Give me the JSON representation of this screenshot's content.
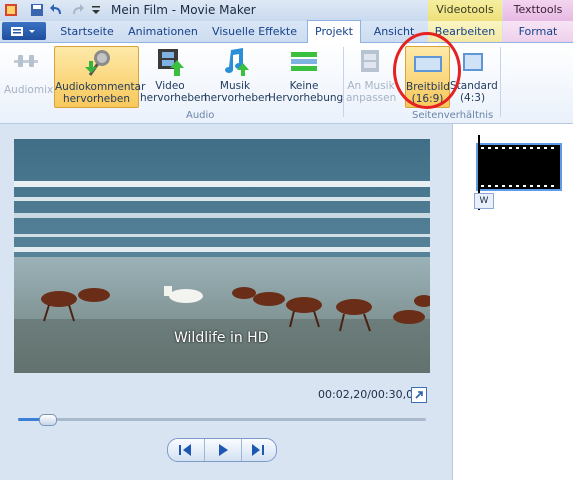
{
  "window": {
    "title": "Mein Film - Movie Maker"
  },
  "context_tabs": {
    "video": "Videotools",
    "text": "Texttools"
  },
  "tabs": [
    {
      "label": "Startseite"
    },
    {
      "label": "Animationen"
    },
    {
      "label": "Visuelle Effekte"
    },
    {
      "label": "Projekt"
    },
    {
      "label": "Ansicht"
    },
    {
      "label": "Bearbeiten"
    },
    {
      "label": "Format"
    }
  ],
  "ribbon": {
    "audiomix": "Audiomix",
    "audiokommentar": [
      "Audiokommentar",
      "hervorheben"
    ],
    "video_hervorheben": [
      "Video",
      "hervorheben"
    ],
    "musik_hervorheben": [
      "Musik",
      "hervorheben"
    ],
    "keine": [
      "Keine",
      "Hervorhebung"
    ],
    "an_musik": [
      "An Musik",
      "anpassen"
    ],
    "breitbild": [
      "Breitbild",
      "(16:9)"
    ],
    "standard": [
      "Standard",
      "(4:3)"
    ],
    "group_audio": "Audio",
    "group_seiten": "Seitenverhältnis"
  },
  "preview": {
    "overlay_text": "Wildlife in HD",
    "timecode": "00:02,20/00:30,09",
    "progress": 0.07
  },
  "storyboard": {
    "caption": "W"
  },
  "colors": {
    "annotation": "#e52222",
    "accent": "#3d7fd6"
  }
}
